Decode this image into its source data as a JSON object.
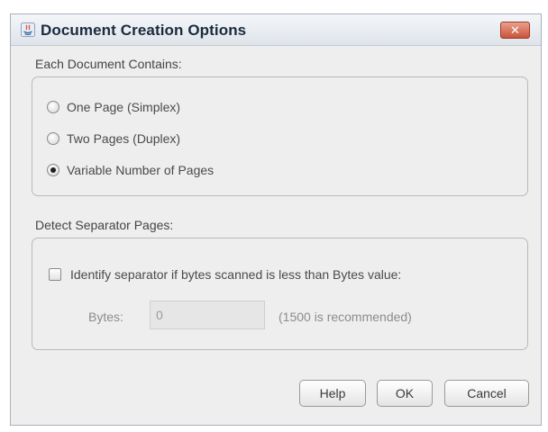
{
  "window": {
    "title": "Document Creation Options",
    "close_symbol": "✕",
    "app_icon": "java-app-icon",
    "close_icon": "close-icon"
  },
  "document_contains": {
    "label": "Each Document Contains:",
    "options": [
      {
        "label": "One Page (Simplex)",
        "selected": false,
        "enabled": false
      },
      {
        "label": "Two Pages (Duplex)",
        "selected": false,
        "enabled": false
      },
      {
        "label": "Variable Number of Pages",
        "selected": true,
        "enabled": true
      }
    ]
  },
  "separator": {
    "label": "Detect Separator Pages:",
    "checkbox_label": "Identify separator if bytes scanned is less than Bytes value:",
    "checked": false,
    "bytes_label": "Bytes:",
    "bytes_value": "0",
    "bytes_hint": "(1500 is recommended)"
  },
  "buttons": {
    "help": "Help",
    "ok": "OK",
    "cancel": "Cancel"
  },
  "colors": {
    "title_text": "#1b2b3d",
    "close_button": "#c9533a",
    "dialog_bg": "#eeeeee"
  }
}
